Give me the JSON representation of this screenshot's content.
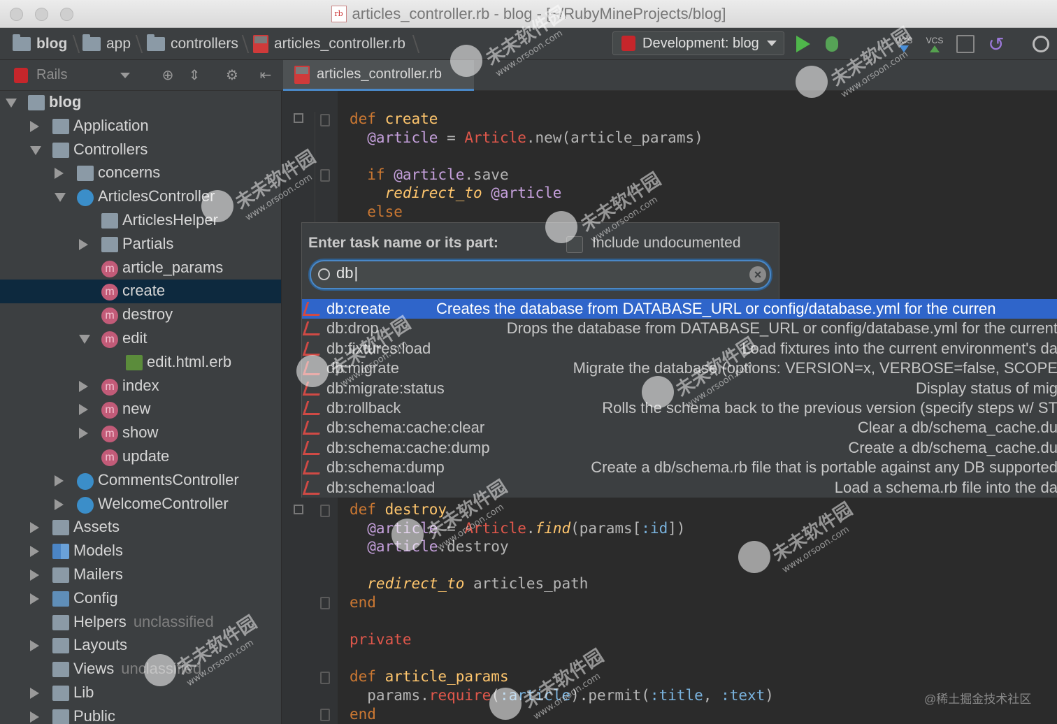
{
  "window": {
    "title": "articles_controller.rb - blog - [~/RubyMineProjects/blog]"
  },
  "navbar": {
    "crumbs": [
      "blog",
      "app",
      "controllers",
      "articles_controller.rb"
    ],
    "run_config": "Development: blog",
    "vcs_label": "VCS",
    "vcs_label_2": "VCS"
  },
  "project_panel": {
    "header": "Rails",
    "tree": [
      {
        "label": "blog",
        "depth": 0,
        "arrow": "down",
        "icon": "project-folder"
      },
      {
        "label": "Application",
        "depth": 1,
        "arrow": "right",
        "icon": "folder"
      },
      {
        "label": "Controllers",
        "depth": 1,
        "arrow": "down",
        "icon": "folder"
      },
      {
        "label": "concerns",
        "depth": 2,
        "arrow": "right",
        "icon": "folder"
      },
      {
        "label": "ArticlesController",
        "depth": 2,
        "arrow": "down",
        "icon": "controller"
      },
      {
        "label": "ArticlesHelper",
        "depth": 3,
        "arrow": "",
        "icon": "helper"
      },
      {
        "label": "Partials",
        "depth": 3,
        "arrow": "right",
        "icon": "folder"
      },
      {
        "label": "article_params",
        "depth": 3,
        "arrow": "",
        "icon": "method"
      },
      {
        "label": "create",
        "depth": 3,
        "arrow": "",
        "icon": "method",
        "selected": true
      },
      {
        "label": "destroy",
        "depth": 3,
        "arrow": "",
        "icon": "method"
      },
      {
        "label": "edit",
        "depth": 3,
        "arrow": "down",
        "icon": "method"
      },
      {
        "label": "edit.html.erb",
        "depth": 4,
        "arrow": "",
        "icon": "erb"
      },
      {
        "label": "index",
        "depth": 3,
        "arrow": "right",
        "icon": "method"
      },
      {
        "label": "new",
        "depth": 3,
        "arrow": "right",
        "icon": "method"
      },
      {
        "label": "show",
        "depth": 3,
        "arrow": "right",
        "icon": "method"
      },
      {
        "label": "update",
        "depth": 3,
        "arrow": "",
        "icon": "method"
      },
      {
        "label": "CommentsController",
        "depth": 2,
        "arrow": "right",
        "icon": "controller"
      },
      {
        "label": "WelcomeController",
        "depth": 2,
        "arrow": "right",
        "icon": "controller"
      },
      {
        "label": "Assets",
        "depth": 1,
        "arrow": "right",
        "icon": "folder"
      },
      {
        "label": "Models",
        "depth": 1,
        "arrow": "right",
        "icon": "models"
      },
      {
        "label": "Mailers",
        "depth": 1,
        "arrow": "right",
        "icon": "folder"
      },
      {
        "label": "Config",
        "depth": 1,
        "arrow": "right",
        "icon": "config"
      },
      {
        "label": "Helpers",
        "depth": 1,
        "arrow": "",
        "icon": "folder",
        "note": "unclassified"
      },
      {
        "label": "Layouts",
        "depth": 1,
        "arrow": "right",
        "icon": "folder"
      },
      {
        "label": "Views",
        "depth": 1,
        "arrow": "",
        "icon": "folder",
        "note": "unclassified"
      },
      {
        "label": "Lib",
        "depth": 1,
        "arrow": "right",
        "icon": "folder"
      },
      {
        "label": "Public",
        "depth": 1,
        "arrow": "right",
        "icon": "folder"
      }
    ]
  },
  "editor": {
    "tab": "articles_controller.rb",
    "lines": [
      {
        "tokens": [
          [
            "kw",
            "def "
          ],
          [
            "fn",
            "create"
          ]
        ]
      },
      {
        "tokens": [
          [
            "ivar",
            "  @article"
          ],
          [
            "plain",
            " = "
          ],
          [
            "const",
            "Article"
          ],
          [
            "plain",
            ".new(article_params)"
          ]
        ]
      },
      {
        "tokens": []
      },
      {
        "tokens": [
          [
            "kw",
            "  if "
          ],
          [
            "ivar",
            "@article"
          ],
          [
            "plain",
            ".save"
          ]
        ]
      },
      {
        "tokens": [
          [
            "ital",
            "    redirect_to "
          ],
          [
            "ivar",
            "@article"
          ]
        ]
      },
      {
        "tokens": [
          [
            "kw",
            "  else"
          ]
        ]
      }
    ],
    "lines_bottom": [
      {
        "tokens": [
          [
            "kw",
            "def "
          ],
          [
            "fn",
            "destroy"
          ]
        ]
      },
      {
        "tokens": [
          [
            "ivar",
            "  @article"
          ],
          [
            "plain",
            " = "
          ],
          [
            "const",
            "Article"
          ],
          [
            "plain",
            "."
          ],
          [
            "ital",
            "find"
          ],
          [
            "plain",
            "(params["
          ],
          [
            "sym",
            ":id"
          ],
          [
            "plain",
            "])"
          ]
        ]
      },
      {
        "tokens": [
          [
            "ivar",
            "  @article"
          ],
          [
            "plain",
            ".destroy"
          ]
        ]
      },
      {
        "tokens": []
      },
      {
        "tokens": [
          [
            "ital",
            "  redirect_to "
          ],
          [
            "plain",
            "articles_path"
          ]
        ]
      },
      {
        "tokens": [
          [
            "kw",
            "end"
          ]
        ]
      },
      {
        "tokens": []
      },
      {
        "tokens": [
          [
            "const",
            "private"
          ]
        ]
      },
      {
        "tokens": []
      },
      {
        "tokens": [
          [
            "kw",
            "def "
          ],
          [
            "fn",
            "article_params"
          ]
        ]
      },
      {
        "tokens": [
          [
            "plain",
            "  params."
          ],
          [
            "const",
            "require"
          ],
          [
            "plain",
            "("
          ],
          [
            "sym",
            ":article"
          ],
          [
            "plain",
            ").permit("
          ],
          [
            "sym",
            ":title"
          ],
          [
            "plain",
            ", "
          ],
          [
            "sym",
            ":text"
          ],
          [
            "plain",
            ")"
          ]
        ]
      },
      {
        "tokens": [
          [
            "kw",
            "end"
          ]
        ]
      }
    ]
  },
  "popup": {
    "title": "Enter task name or its part:",
    "include_undocumented_label": "Include undocumented",
    "search_value": "db",
    "tasks": [
      {
        "name": "db:create",
        "desc": "Creates the database from DATABASE_URL or config/database.yml for the curren",
        "selected": true
      },
      {
        "name": "db:drop",
        "desc": "Drops the database from DATABASE_URL or config/database.yml for the current"
      },
      {
        "name": "db:fixtures:load",
        "desc": "Load fixtures into the current environment's da"
      },
      {
        "name": "db:migrate",
        "desc": "Migrate the database (options: VERSION=x, VERBOSE=false, SCOPE"
      },
      {
        "name": "db:migrate:status",
        "desc": "Display status of mig"
      },
      {
        "name": "db:rollback",
        "desc": "Rolls the schema back to the previous version (specify steps w/ ST"
      },
      {
        "name": "db:schema:cache:clear",
        "desc": "Clear a db/schema_cache.du"
      },
      {
        "name": "db:schema:cache:dump",
        "desc": "Create a db/schema_cache.du"
      },
      {
        "name": "db:schema:dump",
        "desc": "Create a db/schema.rb file that is portable against any DB supported"
      },
      {
        "name": "db:schema:load",
        "desc": "Load a schema.rb file into the da"
      }
    ]
  },
  "watermark": {
    "text": "未未软件园",
    "url": "www.orsoon.com",
    "credit": "@稀土掘金技术社区"
  },
  "colors": {
    "selection": "#2f65ca",
    "tree_selection": "#0d293e",
    "keyword": "#cc7832",
    "function": "#ffc66d"
  }
}
